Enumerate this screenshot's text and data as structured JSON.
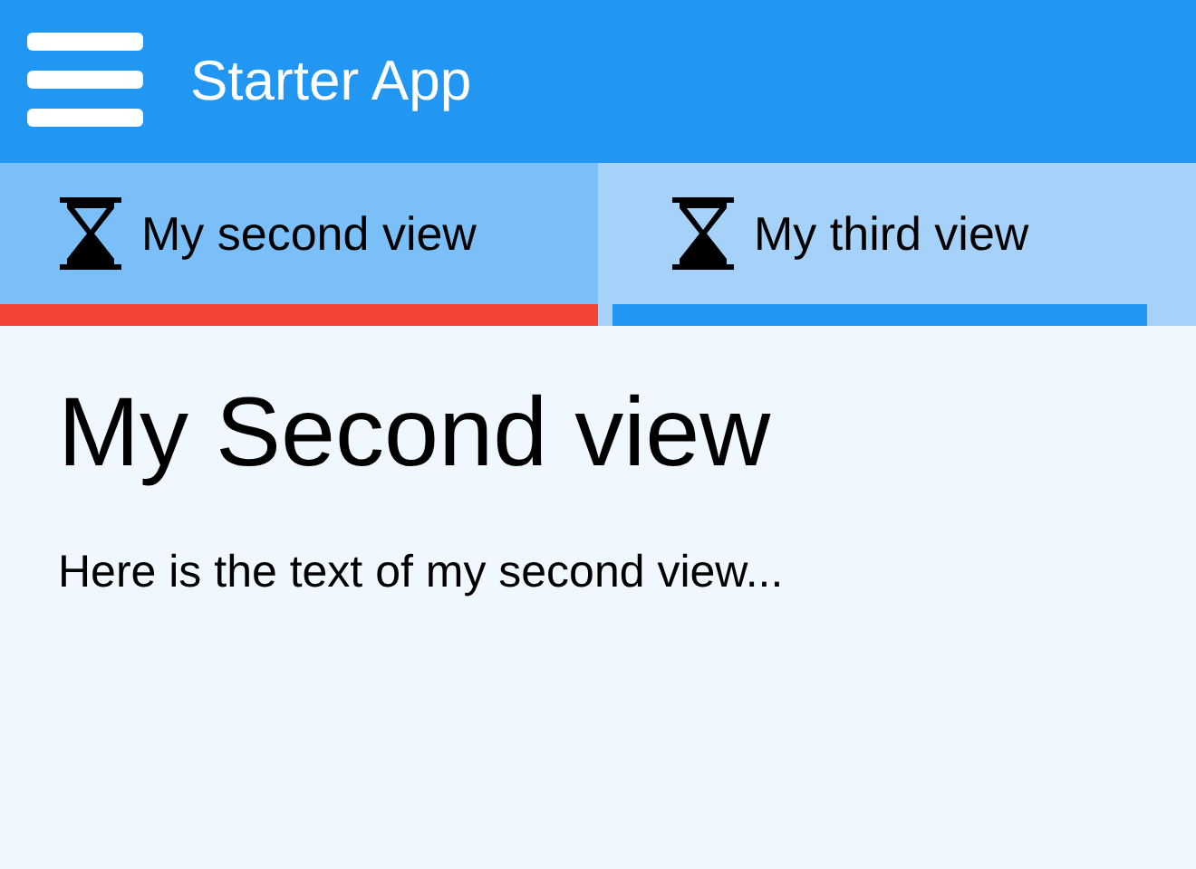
{
  "app_bar": {
    "title": "Starter App"
  },
  "tabs": [
    {
      "label": "My second view",
      "selected": true
    },
    {
      "label": "My third view",
      "selected": false
    }
  ],
  "content": {
    "heading": "My Second view",
    "text": "Here is the text of my second view..."
  }
}
